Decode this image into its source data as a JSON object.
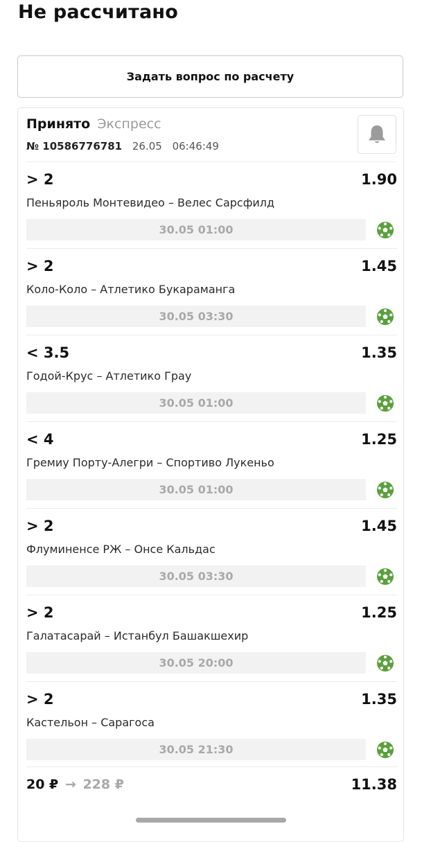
{
  "page": {
    "title": "Не рассчитано"
  },
  "ask_button": {
    "label": "Задать вопрос по расчету"
  },
  "bet": {
    "status": "Принято",
    "type": "Экспресс",
    "number": "№ 10586776781",
    "date": "26.05",
    "time": "06:46:49",
    "notify_icon": "bell-icon",
    "events": [
      {
        "outcome": "> 2",
        "odds": "1.90",
        "teams": "Пеньяроль Монтевидео – Велес Сарсфилд",
        "start": "30.05 01:00",
        "sport_icon": "football-icon"
      },
      {
        "outcome": "> 2",
        "odds": "1.45",
        "teams": "Коло-Коло – Атлетико Букараманга",
        "start": "30.05 03:30",
        "sport_icon": "football-icon"
      },
      {
        "outcome": "< 3.5",
        "odds": "1.35",
        "teams": "Годой-Крус – Атлетико Грау",
        "start": "30.05 01:00",
        "sport_icon": "football-icon"
      },
      {
        "outcome": "< 4",
        "odds": "1.25",
        "teams": "Гремиу Порту-Алегри – Спортиво Лукеньо",
        "start": "30.05 01:00",
        "sport_icon": "football-icon"
      },
      {
        "outcome": "> 2",
        "odds": "1.45",
        "teams": "Флуминенсе РЖ – Онсе Кальдас",
        "start": "30.05 03:30",
        "sport_icon": "football-icon"
      },
      {
        "outcome": "> 2",
        "odds": "1.25",
        "teams": "Галатасарай – Истанбул Башакшехир",
        "start": "30.05 20:00",
        "sport_icon": "football-icon"
      },
      {
        "outcome": "> 2",
        "odds": "1.35",
        "teams": "Кастельон – Сарагоса",
        "start": "30.05 21:30",
        "sport_icon": "football-icon"
      }
    ],
    "stake": "20 ₽",
    "arrow": "→",
    "potential_payout": "228 ₽",
    "total_odds": "11.38"
  },
  "colors": {
    "accent_green": "#5aa03c",
    "muted_gray": "#a9a9a9",
    "bar_background": "#f2f2f2"
  }
}
